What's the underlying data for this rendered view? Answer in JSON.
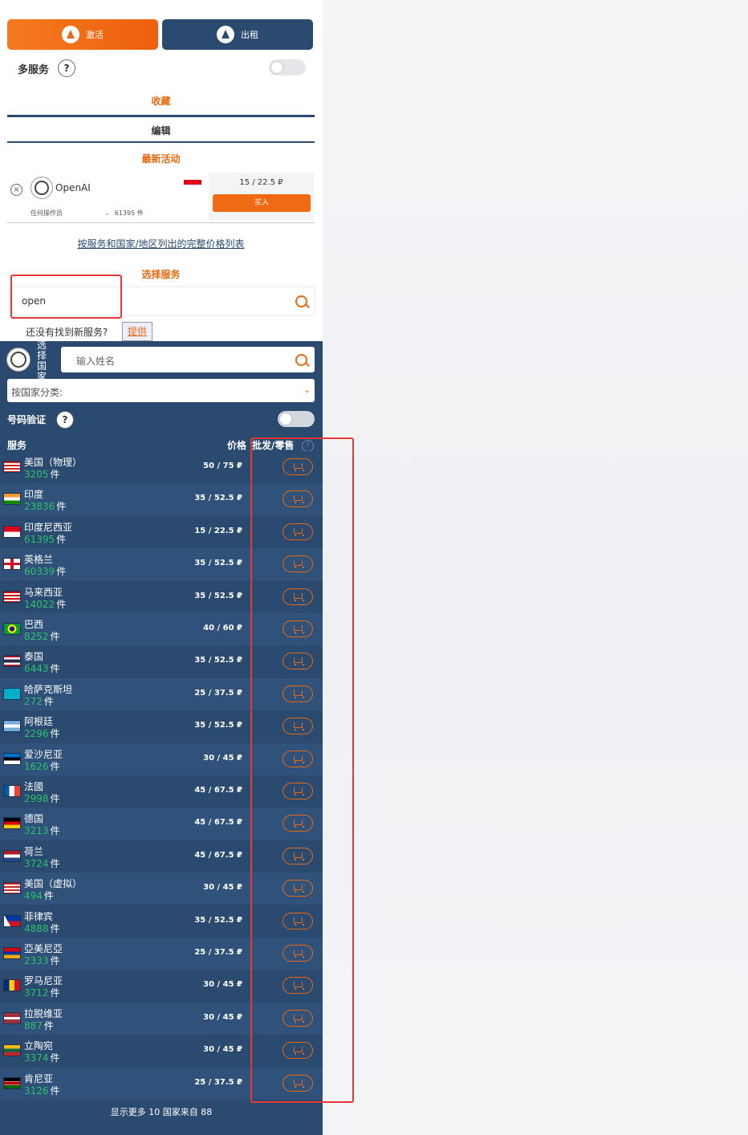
{
  "tabs": {
    "activate": "激活",
    "rent": "出租"
  },
  "multi_service": {
    "label": "多服务",
    "help": "?"
  },
  "favorites": "收藏",
  "edit": "编辑",
  "latest_activity": {
    "title": "最新活动",
    "close": "×",
    "service": "OpenAI",
    "price": "15 / 22.5 ₽",
    "buy": "买入",
    "operator": "任何操作员",
    "count": "61395 件"
  },
  "price_list_link": "按服务和国家/地区列出的完整价格列表",
  "choose_service": {
    "title": "选择服务",
    "value": "open"
  },
  "not_found": {
    "text": "还没有找到新服务?",
    "provide": "提供"
  },
  "choose_country": {
    "label": "选择国家",
    "search_placeholder": "输入姓名",
    "sort_label": "按国家分类:",
    "sort_chevron": "⌄"
  },
  "number_verify": {
    "label": "号码验证",
    "help": "?"
  },
  "table_header": {
    "service": "服务",
    "price": "价格",
    "wholesale": "批发/零售",
    "help": "?"
  },
  "countries": [
    {
      "name": "美国（物理）",
      "count": "3205",
      "unit": "件",
      "price": "50 / 75 ₽",
      "flag": "us"
    },
    {
      "name": "印度",
      "count": "23836",
      "unit": "件",
      "price": "35 / 52.5 ₽",
      "flag": "in"
    },
    {
      "name": "印度尼西亚",
      "count": "61395",
      "unit": "件",
      "price": "15 / 22.5 ₽",
      "flag": "id"
    },
    {
      "name": "英格兰",
      "count": "60339",
      "unit": "件",
      "price": "35 / 52.5 ₽",
      "flag": "gb-eng"
    },
    {
      "name": "马来西亚",
      "count": "14022",
      "unit": "件",
      "price": "35 / 52.5 ₽",
      "flag": "my"
    },
    {
      "name": "巴西",
      "count": "8252",
      "unit": "件",
      "price": "40 / 60 ₽",
      "flag": "br"
    },
    {
      "name": "泰国",
      "count": "6443",
      "unit": "件",
      "price": "35 / 52.5 ₽",
      "flag": "th"
    },
    {
      "name": "哈萨克斯坦",
      "count": "272",
      "unit": "件",
      "price": "25 / 37.5 ₽",
      "flag": "kz"
    },
    {
      "name": "阿根廷",
      "count": "2296",
      "unit": "件",
      "price": "35 / 52.5 ₽",
      "flag": "ar"
    },
    {
      "name": "爱沙尼亚",
      "count": "1626",
      "unit": "件",
      "price": "30 / 45 ₽",
      "flag": "ee"
    },
    {
      "name": "法國",
      "count": "2998",
      "unit": "件",
      "price": "45 / 67.5 ₽",
      "flag": "fr"
    },
    {
      "name": "德国",
      "count": "3213",
      "unit": "件",
      "price": "45 / 67.5 ₽",
      "flag": "de"
    },
    {
      "name": "荷兰",
      "count": "3724",
      "unit": "件",
      "price": "45 / 67.5 ₽",
      "flag": "nl"
    },
    {
      "name": "美国（虚拟）",
      "count": "494",
      "unit": "件",
      "price": "30 / 45 ₽",
      "flag": "us"
    },
    {
      "name": "菲律宾",
      "count": "4888",
      "unit": "件",
      "price": "35 / 52.5 ₽",
      "flag": "ph"
    },
    {
      "name": "亞美尼亞",
      "count": "2333",
      "unit": "件",
      "price": "25 / 37.5 ₽",
      "flag": "am"
    },
    {
      "name": "罗马尼亚",
      "count": "3712",
      "unit": "件",
      "price": "30 / 45 ₽",
      "flag": "ro"
    },
    {
      "name": "拉脱维亚",
      "count": "887",
      "unit": "件",
      "price": "30 / 45 ₽",
      "flag": "lv"
    },
    {
      "name": "立陶宛",
      "count": "3374",
      "unit": "件",
      "price": "30 / 45 ₽",
      "flag": "lt"
    },
    {
      "name": "肯尼亚",
      "count": "3126",
      "unit": "件",
      "price": "25 / 37.5 ₽",
      "flag": "ke"
    }
  ],
  "show_more": "显示更多 10 国家来自 88",
  "bottom_chevron": "⌄",
  "colors": {
    "accent": "#e8690f",
    "navy": "#2a4a70",
    "count_green": "#2bc26b",
    "highlight_red": "#e53935"
  }
}
